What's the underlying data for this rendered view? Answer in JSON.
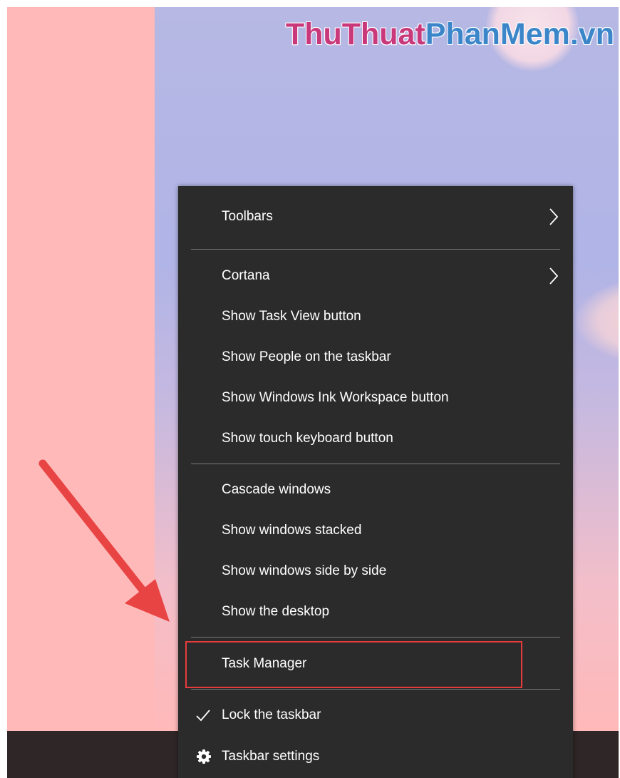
{
  "watermark": {
    "part_pink": "ThuThuat",
    "part_blue": "PhanMem.vn",
    "pink_color": "#c9387a",
    "blue_color": "#3b86c9"
  },
  "annotation": {
    "arrow_color": "#e94444",
    "highlight_color": "#e63b3b"
  },
  "context_menu": {
    "background": "#2b2b2b",
    "items": {
      "toolbars": {
        "label": "Toolbars",
        "icon": "chevron-right-icon"
      },
      "cortana": {
        "label": "Cortana",
        "icon": "chevron-right-icon"
      },
      "show_task_view": {
        "label": "Show Task View button"
      },
      "show_people": {
        "label": "Show People on the taskbar"
      },
      "show_ink_workspace": {
        "label": "Show Windows Ink Workspace button"
      },
      "show_touch_keyboard": {
        "label": "Show touch keyboard button"
      },
      "cascade_windows": {
        "label": "Cascade windows"
      },
      "show_stacked": {
        "label": "Show windows stacked"
      },
      "show_side_by_side": {
        "label": "Show windows side by side"
      },
      "show_desktop": {
        "label": "Show the desktop"
      },
      "task_manager": {
        "label": "Task Manager"
      },
      "lock_taskbar": {
        "label": "Lock the taskbar",
        "icon": "checkmark-icon",
        "checked": true
      },
      "taskbar_settings": {
        "label": "Taskbar settings",
        "icon": "gear-icon"
      }
    }
  }
}
